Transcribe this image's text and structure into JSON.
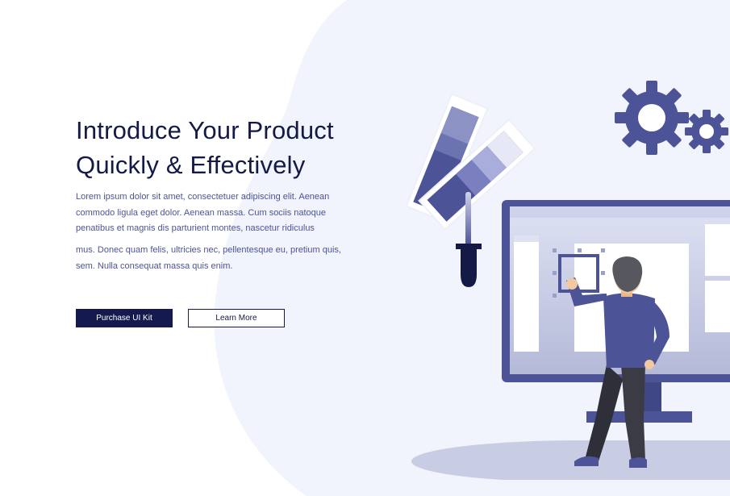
{
  "hero": {
    "title_line1": "Introduce Your Product",
    "title_line2": "Quickly & Effectively",
    "paragraph1": "Lorem ipsum dolor sit amet, consectetuer adipiscing elit. Aenean commodo ligula eget dolor. Aenean massa. Cum sociis natoque penatibus et magnis dis parturient montes, nascetur ridiculus",
    "paragraph2": "mus. Donec quam felis, ultricies nec, pellentesque eu, pretium quis, sem. Nulla consequat massa quis enim.",
    "primary_button": "Purchase UI Kit",
    "secondary_button": "Learn More"
  },
  "colors": {
    "navy": "#141a46",
    "accent": "#4c5497",
    "background_blob": "#f1f3fd",
    "shadow": "#c9cde3"
  },
  "illustration": {
    "icons": [
      "color-swatch-icon",
      "pipette-icon",
      "gear-icon",
      "monitor-icon",
      "person-figure"
    ]
  }
}
